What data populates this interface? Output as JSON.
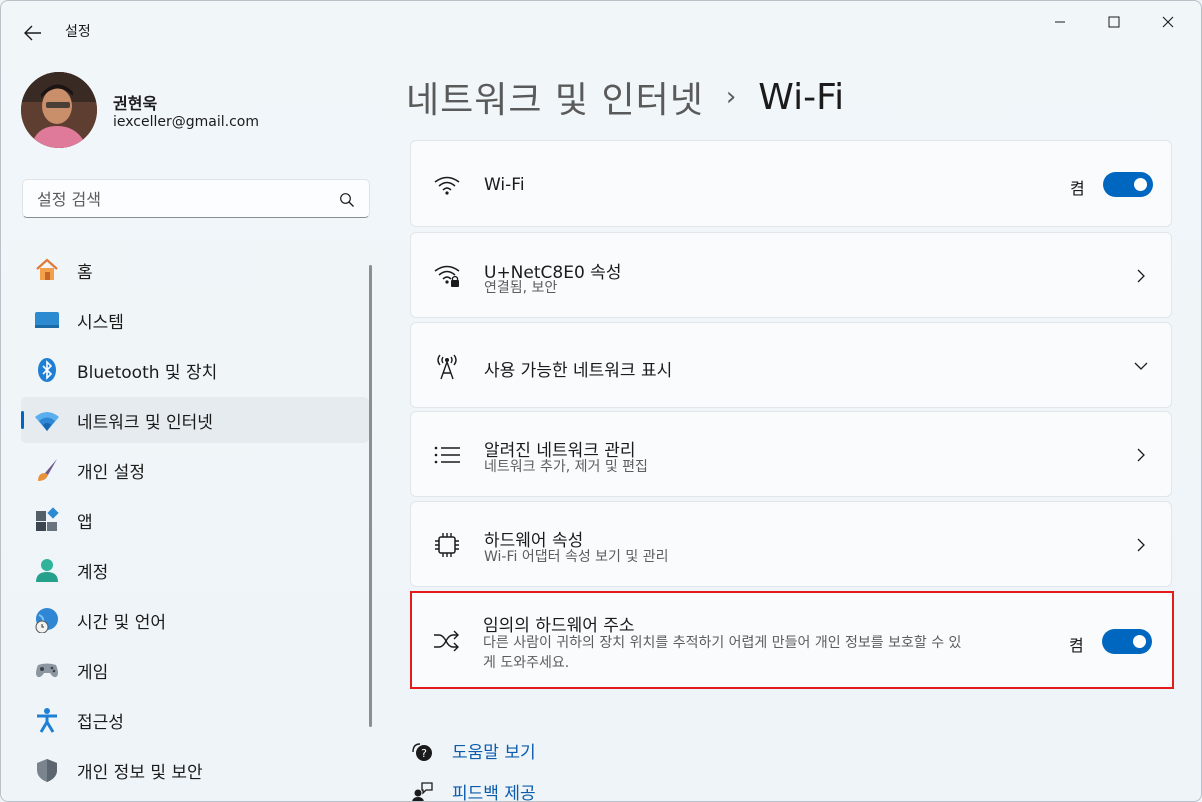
{
  "app": {
    "title": "설정"
  },
  "user": {
    "name": "권현욱",
    "email": "iexceller@gmail.com"
  },
  "search": {
    "placeholder": "설정 검색"
  },
  "nav": [
    {
      "label": "홈",
      "icon": "home-icon"
    },
    {
      "label": "시스템",
      "icon": "system-icon"
    },
    {
      "label": "Bluetooth 및 장치",
      "icon": "bluetooth-icon"
    },
    {
      "label": "네트워크 및 인터넷",
      "icon": "network-icon",
      "active": true
    },
    {
      "label": "개인 설정",
      "icon": "brush-icon"
    },
    {
      "label": "앱",
      "icon": "apps-icon"
    },
    {
      "label": "계정",
      "icon": "account-icon"
    },
    {
      "label": "시간 및 언어",
      "icon": "time-language-icon"
    },
    {
      "label": "게임",
      "icon": "gamepad-icon"
    },
    {
      "label": "접근성",
      "icon": "accessibility-icon"
    },
    {
      "label": "개인 정보 및 보안",
      "icon": "shield-icon"
    }
  ],
  "breadcrumb": {
    "parent": "네트워크 및 인터넷",
    "separator": "›",
    "current": "Wi-Fi"
  },
  "cards": {
    "wifi": {
      "title": "Wi-Fi",
      "state": "켬",
      "on": true
    },
    "connected": {
      "title": "U+NetC8E0 속성",
      "subtitle": "연결됨, 보안"
    },
    "available": {
      "title": "사용 가능한 네트워크 표시"
    },
    "known": {
      "title": "알려진 네트워크 관리",
      "subtitle": "네트워크 추가, 제거 및 편집"
    },
    "hardware": {
      "title": "하드웨어 속성",
      "subtitle": "Wi-Fi 어댑터 속성 보기 및 관리"
    },
    "random": {
      "title": "임의의 하드웨어 주소",
      "subtitle_line1": "다른 사람이 귀하의 장치 위치를 추적하기 어렵게 만들어 개인 정보를 보호할 수 있",
      "subtitle_line2": "게 도와주세요.",
      "state": "켬",
      "on": true
    }
  },
  "links": {
    "help": "도움말 보기",
    "feedback": "피드백 제공"
  },
  "colors": {
    "accent": "#0067c0",
    "highlight": "#e31b1b",
    "link": "#0b5cad"
  }
}
